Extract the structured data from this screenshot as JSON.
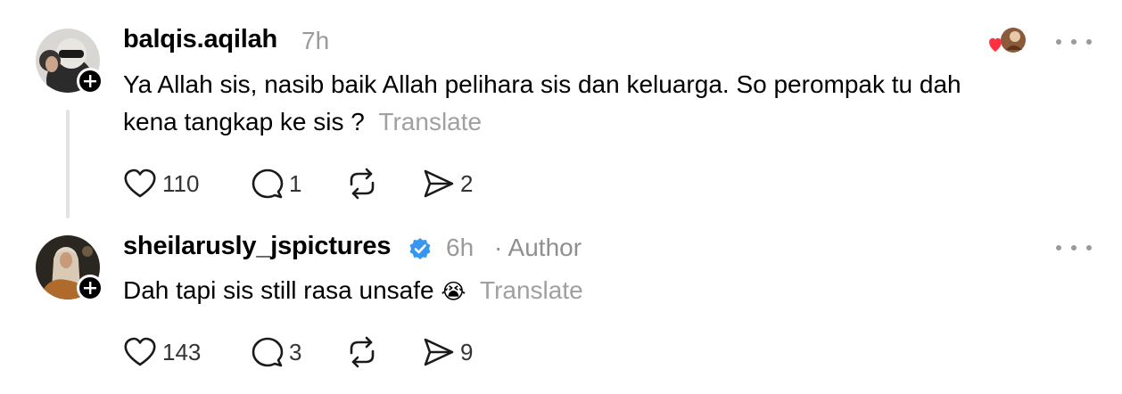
{
  "posts": [
    {
      "username": "balqis.aqilah",
      "time": "7h",
      "author_tag": "",
      "verified": false,
      "text_line1": "Ya Allah sis, nasib baik Allah pelihara sis dan keluarga. So perompak tu dah",
      "text_line2": "kena tangkap ke sis ?",
      "translate": "Translate",
      "likes": "110",
      "replies": "1",
      "reposts": "",
      "shares": "2",
      "liked_by_author": true
    },
    {
      "username": "sheilarusly_jspictures",
      "time": "6h",
      "author_tag": "· Author",
      "verified": true,
      "text": "Dah tapi sis still rasa unsafe",
      "emoji": "😭",
      "translate": "Translate",
      "likes": "143",
      "replies": "3",
      "reposts": "",
      "shares": "9"
    }
  ],
  "icons": {
    "like": "heart-icon",
    "reply": "speech-bubble-icon",
    "repost": "repost-arrows-icon",
    "share": "send-arrow-icon",
    "more": "more-dots-icon",
    "follow": "plus-icon",
    "verified": "verified-badge-icon"
  },
  "colors": {
    "text": "#000000",
    "muted": "#9a9a9a",
    "verified": "#3797f0",
    "liked_heart": "#ff3040"
  }
}
